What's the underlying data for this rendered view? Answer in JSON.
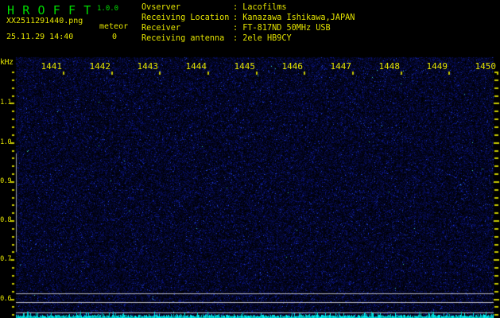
{
  "app": {
    "title": "H R O F F T",
    "version": "1.0.0"
  },
  "capture": {
    "filename": "XX2511291440.png",
    "mode": "meteor",
    "count": "0",
    "datetime": "25.11.29 14:40"
  },
  "info": {
    "separator": ": ",
    "rows": [
      {
        "label": "Ovserver",
        "value": "Lacofilms"
      },
      {
        "label": "Receiving Location",
        "value": "Kanazawa Ishikawa,JAPAN"
      },
      {
        "label": "Receiver",
        "value": "FT-817ND 50MHz USB"
      },
      {
        "label": "Receiving antenna",
        "value": "2ele HB9CY"
      }
    ]
  },
  "chart_data": {
    "type": "heatmap",
    "subtype": "radio-spectrogram",
    "x_axis": {
      "unit": "hhmm",
      "labels": [
        "1441",
        "1442",
        "1443",
        "1444",
        "1445",
        "1446",
        "1447",
        "1448",
        "1449",
        "1450"
      ]
    },
    "y_axis": {
      "unit": "kHz",
      "major_labels": [
        "1.1",
        "1.0",
        "0.9",
        "0.8",
        "0.7",
        "0.6"
      ],
      "min_khz": 0.56,
      "max_khz": 1.18,
      "major_step_khz": 0.1,
      "minor_step_khz": 0.02
    },
    "h_marker_lines_khz": [
      0.616,
      0.592,
      0.567
    ],
    "v_marker": {
      "minute_offset": 0,
      "from_khz": 0.72,
      "to_khz": 0.973
    },
    "content": "background noise only, no meteor echoes",
    "colors": {
      "text_yellow": "#e3e300",
      "text_green": "#00dd00",
      "tick": "#c9c900",
      "marker_line": "#b9b9c0",
      "v_marker_line": "#9aa0a8",
      "activity_bar": "#00e0e0",
      "noise_base": "#000020"
    }
  }
}
